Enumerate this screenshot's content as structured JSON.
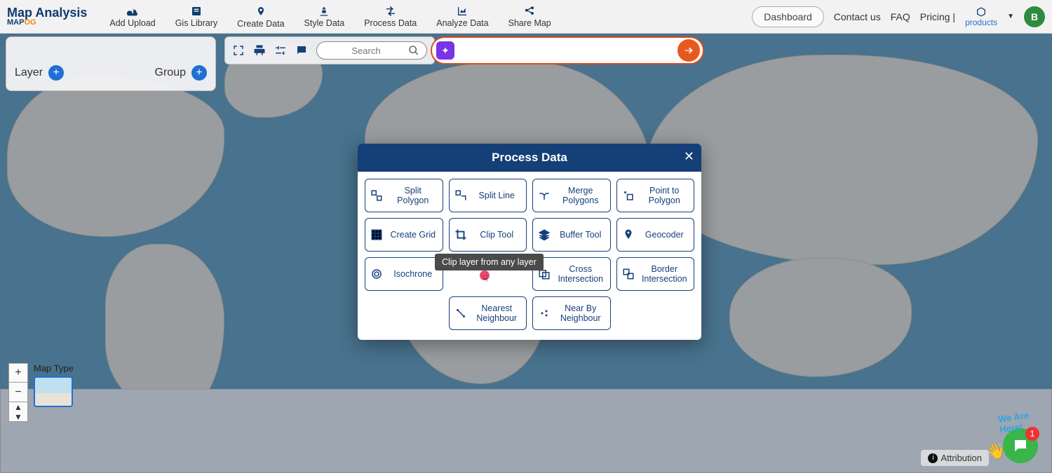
{
  "brand": {
    "title": "Map Analysis",
    "sub1": "MAP",
    "sub2": "OG"
  },
  "nav": {
    "upload": "Add Upload",
    "library": "Gis Library",
    "create": "Create Data",
    "style": "Style Data",
    "process": "Process Data",
    "analyze": "Analyze Data",
    "share": "Share Map"
  },
  "top_right": {
    "dashboard": "Dashboard",
    "contact": "Contact us",
    "faq": "FAQ",
    "pricing": "Pricing |",
    "products": "products",
    "avatar": "B"
  },
  "toolstrip": {
    "search_placeholder": "Search"
  },
  "layer_panel": {
    "layer": "Layer",
    "group": "Group"
  },
  "maptype_label": "Map Type",
  "attribution": "Attribution",
  "chat": {
    "halo": "We Are Here!",
    "badge": "1"
  },
  "modal": {
    "title": "Process Data",
    "tools": {
      "split_polygon": "Split Polygon",
      "split_line": "Split Line",
      "merge_polygons": "Merge Polygons",
      "point_to_polygon": "Point to Polygon",
      "create_grid": "Create Grid",
      "clip_tool": "Clip Tool",
      "buffer_tool": "Buffer Tool",
      "geocoder": "Geocoder",
      "isochrone": "Isochrone",
      "cross_intersection": "Cross Intersection",
      "border_intersection": "Border Intersection",
      "nearest_neighbour": "Nearest Neighbour",
      "nearby_neighbour": "Near By Neighbour"
    }
  },
  "tooltip": "Clip layer from any layer"
}
